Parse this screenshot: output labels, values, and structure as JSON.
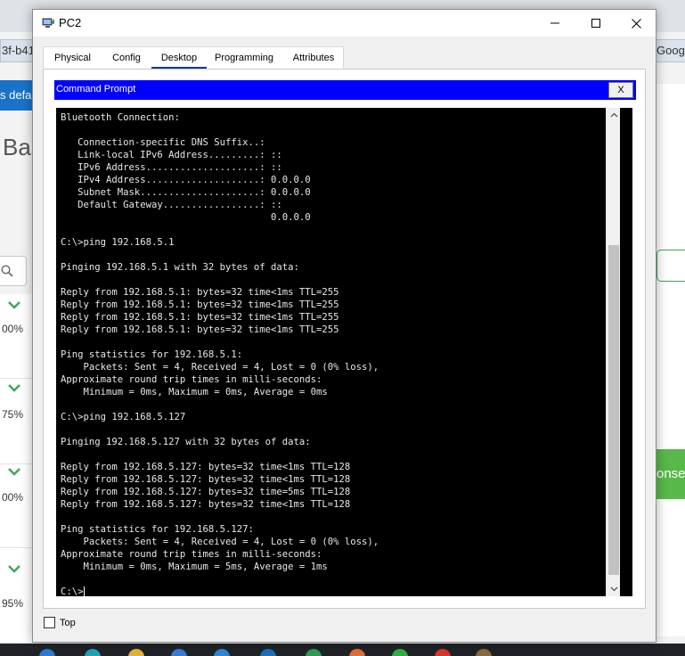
{
  "background": {
    "left_tab_fragment": "3f-b41",
    "right_tab_fragment": "Googl",
    "blue_button_fragment": "s defau",
    "heading_fragment": "Bas",
    "percentages": [
      "00%",
      "75%",
      "00%",
      "95%"
    ],
    "green_button_fragment": "onse"
  },
  "window": {
    "title": "PC2",
    "tabs": [
      {
        "label": "Physical"
      },
      {
        "label": "Config"
      },
      {
        "label": "Desktop"
      },
      {
        "label": "Programming"
      },
      {
        "label": "Attributes"
      }
    ],
    "active_tab": "Desktop",
    "command_prompt": {
      "title": "Command Prompt",
      "close_label": "X",
      "output": "Bluetooth Connection:\n\n   Connection-specific DNS Suffix..:\n   Link-local IPv6 Address.........: ::\n   IPv6 Address....................: ::\n   IPv4 Address....................: 0.0.0.0\n   Subnet Mask.....................: 0.0.0.0\n   Default Gateway.................: ::\n                                     0.0.0.0\n\nC:\\>ping 192.168.5.1\n\nPinging 192.168.5.1 with 32 bytes of data:\n\nReply from 192.168.5.1: bytes=32 time<1ms TTL=255\nReply from 192.168.5.1: bytes=32 time<1ms TTL=255\nReply from 192.168.5.1: bytes=32 time<1ms TTL=255\nReply from 192.168.5.1: bytes=32 time<1ms TTL=255\n\nPing statistics for 192.168.5.1:\n    Packets: Sent = 4, Received = 4, Lost = 0 (0% loss),\nApproximate round trip times in milli-seconds:\n    Minimum = 0ms, Maximum = 0ms, Average = 0ms\n\nC:\\>ping 192.168.5.127\n\nPinging 192.168.5.127 with 32 bytes of data:\n\nReply from 192.168.5.127: bytes=32 time<1ms TTL=128\nReply from 192.168.5.127: bytes=32 time<1ms TTL=128\nReply from 192.168.5.127: bytes=32 time=5ms TTL=128\nReply from 192.168.5.127: bytes=32 time<1ms TTL=128\n\nPing statistics for 192.168.5.127:\n    Packets: Sent = 4, Received = 4, Lost = 0 (0% loss),\nApproximate round trip times in milli-seconds:\n    Minimum = 0ms, Maximum = 5ms, Average = 1ms\n\n",
      "prompt": "C:\\>"
    },
    "top_checkbox_label": "Top",
    "top_checked": false
  },
  "colors": {
    "command_header": "#0000ff",
    "console_bg": "#000000",
    "console_text": "#e8e8e8",
    "active_tab_underline": "#0a3d91"
  },
  "icons": [
    "packet-tracer-pc-icon",
    "minimize-icon",
    "maximize-icon",
    "close-icon",
    "scroll-up-arrow-icon",
    "scroll-down-arrow-icon",
    "search-icon",
    "chevron-down-icon"
  ]
}
